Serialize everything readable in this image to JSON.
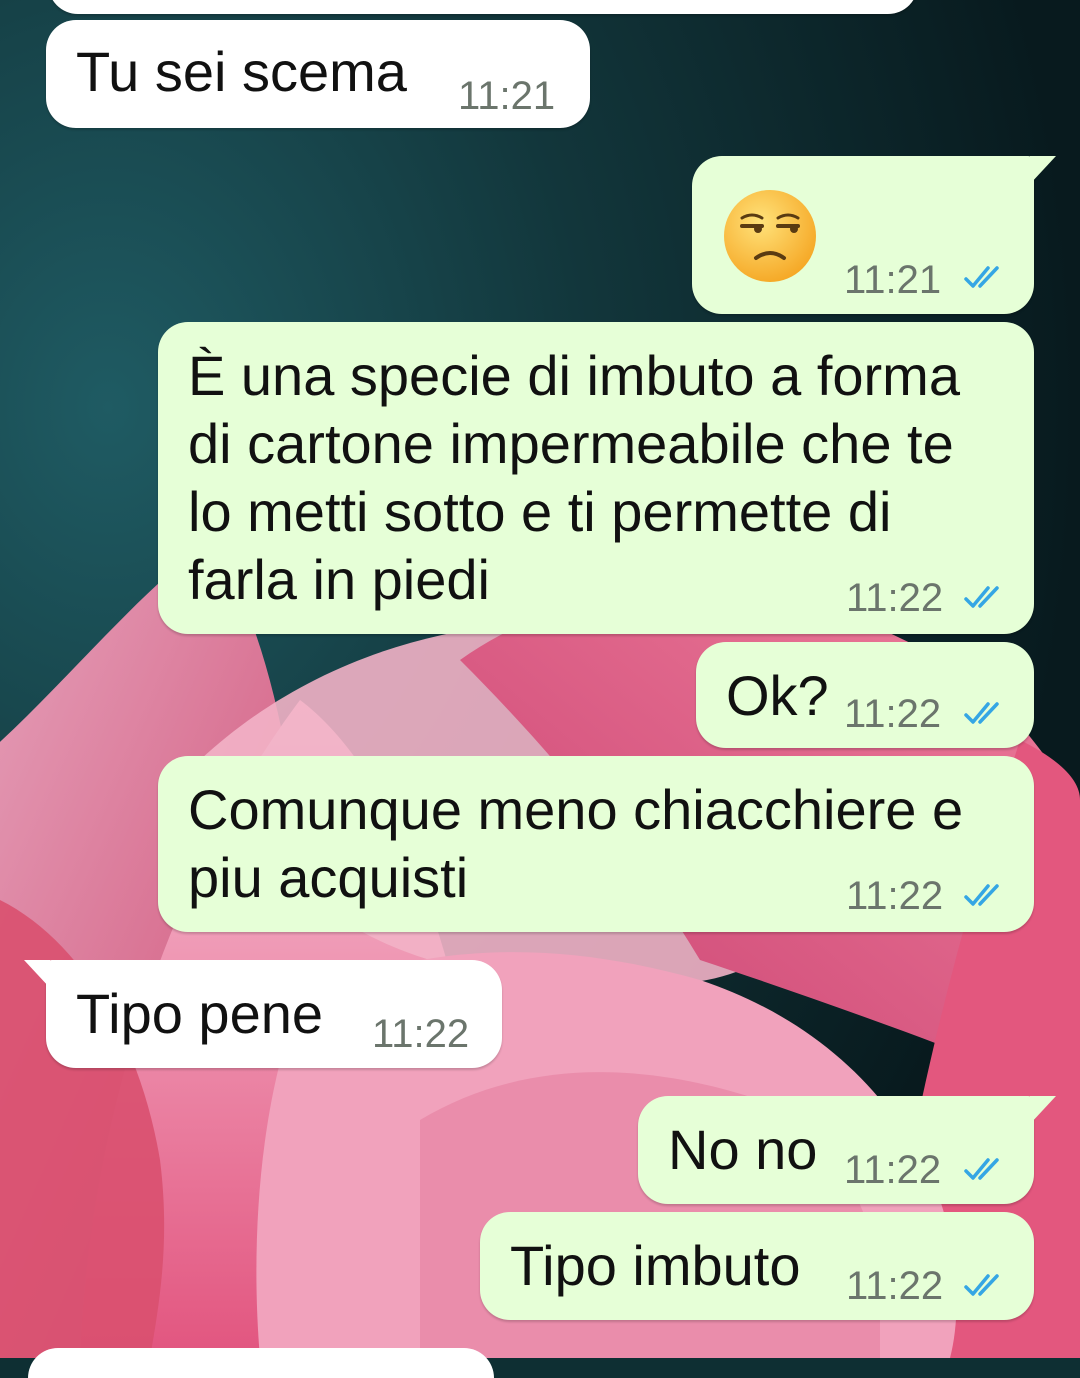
{
  "theme": {
    "incoming_bubble": "#ffffff",
    "outgoing_bubble": "#e6ffd7",
    "read_tick_color": "#35a6e4",
    "time_color": "#6b756c"
  },
  "messages": [
    {
      "direction": "incoming",
      "text": "Tu sei scema",
      "time": "11:21"
    },
    {
      "direction": "outgoing",
      "emoji": "😒",
      "emoji_name": "unamused-face-icon",
      "time": "11:21",
      "status": "read"
    },
    {
      "direction": "outgoing",
      "lines": [
        "È una specie di imbuto a forma",
        "di cartone impermeabile che te",
        "lo metti sotto e ti permette di",
        "farla in piedi"
      ],
      "time": "11:22",
      "status": "read"
    },
    {
      "direction": "outgoing",
      "text": "Ok?",
      "time": "11:22",
      "status": "read"
    },
    {
      "direction": "outgoing",
      "lines": [
        "Comunque meno chiacchiere e",
        "piu acquisti"
      ],
      "time": "11:22",
      "status": "read"
    },
    {
      "direction": "incoming",
      "text": "Tipo pene",
      "time": "11:22"
    },
    {
      "direction": "outgoing",
      "text": "No no",
      "time": "11:22",
      "status": "read"
    },
    {
      "direction": "outgoing",
      "text": "Tipo imbuto",
      "time": "11:22",
      "status": "read"
    }
  ]
}
